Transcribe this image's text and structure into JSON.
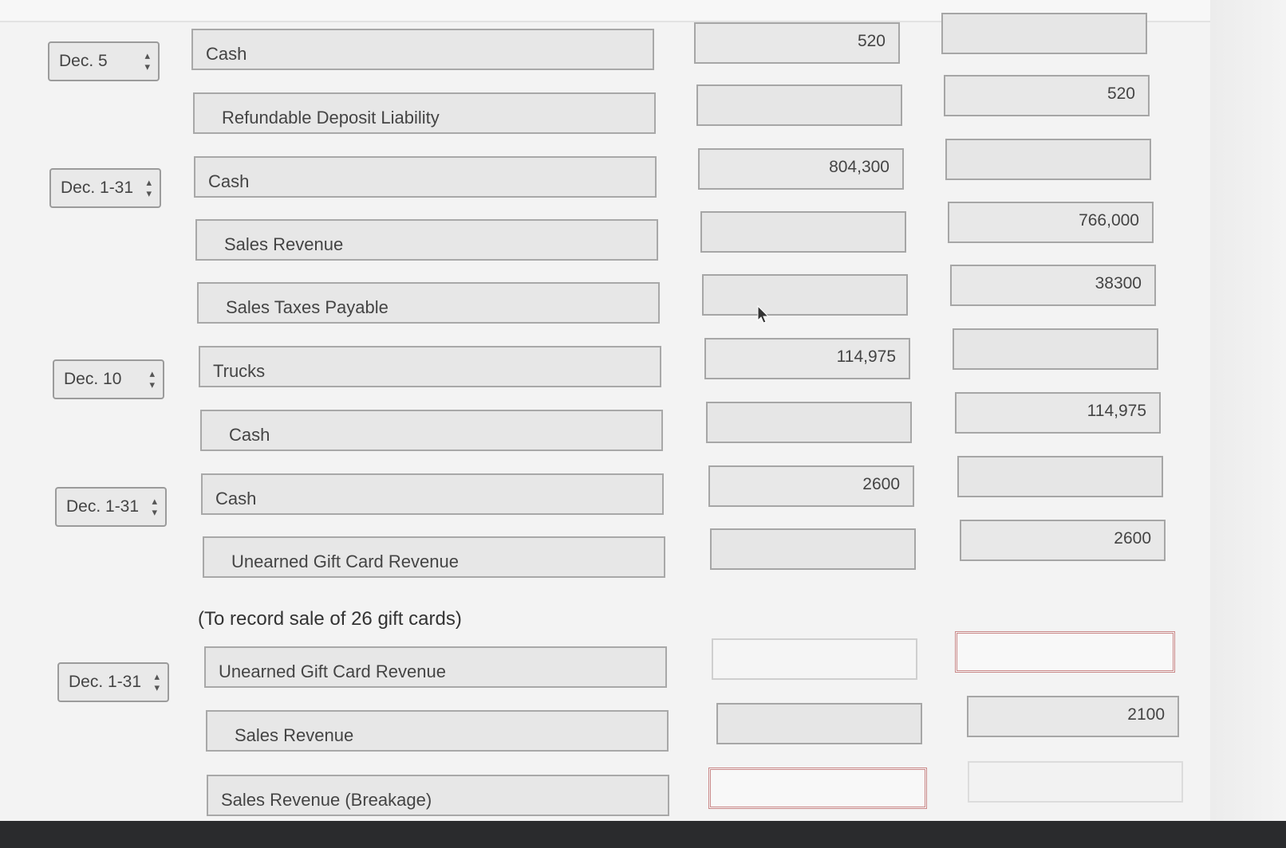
{
  "entries": [
    {
      "date": "Dec. 5",
      "lines": [
        {
          "account": "Cash",
          "debit": "520",
          "credit": ""
        },
        {
          "account": "Refundable Deposit Liability",
          "debit": "",
          "credit": "520"
        }
      ]
    },
    {
      "date": "Dec. 1-31",
      "lines": [
        {
          "account": "Cash",
          "debit": "804,300",
          "credit": ""
        },
        {
          "account": "Sales Revenue",
          "debit": "",
          "credit": "766,000"
        },
        {
          "account": "Sales Taxes Payable",
          "debit": "",
          "credit": "38300"
        }
      ]
    },
    {
      "date": "Dec. 10",
      "lines": [
        {
          "account": "Trucks",
          "debit": "114,975",
          "credit": ""
        },
        {
          "account": "Cash",
          "debit": "",
          "credit": "114,975"
        }
      ]
    },
    {
      "date": "Dec. 1-31",
      "lines": [
        {
          "account": "Cash",
          "debit": "2600",
          "credit": ""
        },
        {
          "account": "Unearned Gift Card Revenue",
          "debit": "",
          "credit": "2600"
        }
      ],
      "note": "(To record sale of 26 gift cards)"
    },
    {
      "date": "Dec. 1-31",
      "lines": [
        {
          "account": "Unearned Gift Card Revenue",
          "debit": "",
          "credit": ""
        },
        {
          "account": "Sales Revenue",
          "debit": "",
          "credit": "2100"
        },
        {
          "account": "Sales Revenue (Breakage)",
          "debit": "",
          "credit": ""
        }
      ]
    }
  ]
}
